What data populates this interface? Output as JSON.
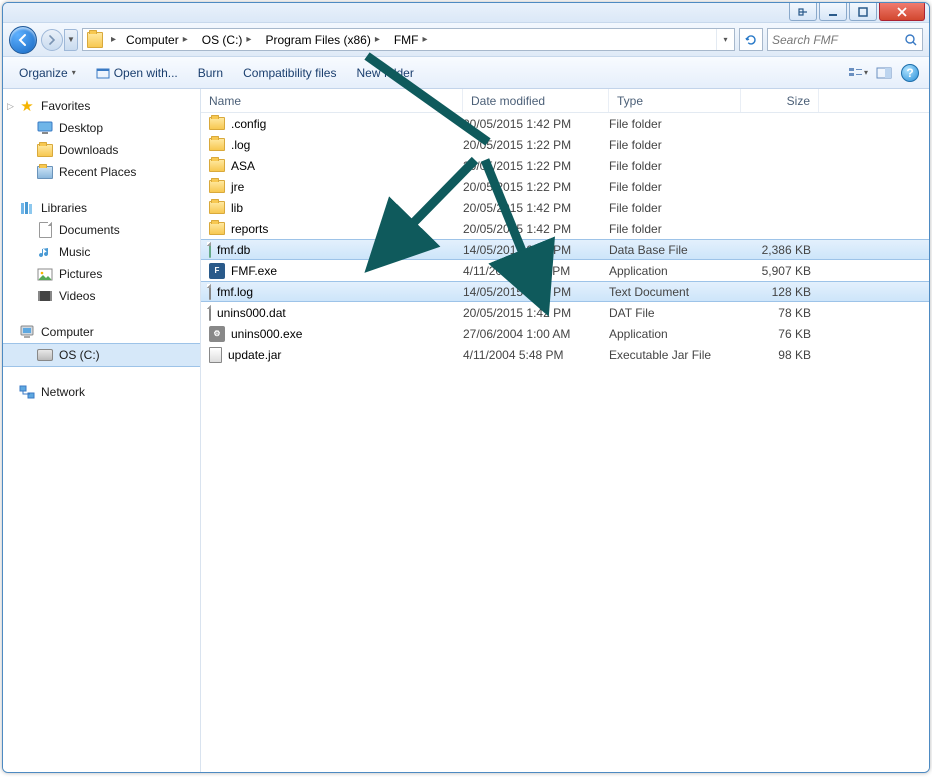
{
  "breadcrumb": {
    "seg0": "Computer",
    "seg1": "OS (C:)",
    "seg2": "Program Files (x86)",
    "seg3": "FMF"
  },
  "search": {
    "placeholder": "Search FMF"
  },
  "toolbar": {
    "organize": "Organize",
    "openwith": "Open with...",
    "burn": "Burn",
    "compat": "Compatibility files",
    "newfolder": "New folder"
  },
  "columns": {
    "name": "Name",
    "date": "Date modified",
    "type": "Type",
    "size": "Size"
  },
  "sidebar": {
    "favorites": "Favorites",
    "desktop": "Desktop",
    "downloads": "Downloads",
    "recent": "Recent Places",
    "libraries": "Libraries",
    "documents": "Documents",
    "music": "Music",
    "pictures": "Pictures",
    "videos": "Videos",
    "computer": "Computer",
    "osc": "OS (C:)",
    "network": "Network"
  },
  "files": {
    "r0": {
      "name": ".config",
      "date": "20/05/2015 1:42 PM",
      "type": "File folder",
      "size": ""
    },
    "r1": {
      "name": ".log",
      "date": "20/05/2015 1:22 PM",
      "type": "File folder",
      "size": ""
    },
    "r2": {
      "name": "ASA",
      "date": "20/05/2015 1:22 PM",
      "type": "File folder",
      "size": ""
    },
    "r3": {
      "name": "jre",
      "date": "20/05/2015 1:22 PM",
      "type": "File folder",
      "size": ""
    },
    "r4": {
      "name": "lib",
      "date": "20/05/2015 1:42 PM",
      "type": "File folder",
      "size": ""
    },
    "r5": {
      "name": "reports",
      "date": "20/05/2015 1:42 PM",
      "type": "File folder",
      "size": ""
    },
    "r6": {
      "name": "fmf.db",
      "date": "14/05/2015 2:28 PM",
      "type": "Data Base File",
      "size": "2,386 KB"
    },
    "r7": {
      "name": "FMF.exe",
      "date": "4/11/2004 10:23 PM",
      "type": "Application",
      "size": "5,907 KB"
    },
    "r8": {
      "name": "fmf.log",
      "date": "14/05/2015 2:25 PM",
      "type": "Text Document",
      "size": "128 KB"
    },
    "r9": {
      "name": "unins000.dat",
      "date": "20/05/2015 1:42 PM",
      "type": "DAT File",
      "size": "78 KB"
    },
    "r10": {
      "name": "unins000.exe",
      "date": "27/06/2004 1:00 AM",
      "type": "Application",
      "size": "76 KB"
    },
    "r11": {
      "name": "update.jar",
      "date": "4/11/2004 5:48 PM",
      "type": "Executable Jar File",
      "size": "98 KB"
    }
  }
}
